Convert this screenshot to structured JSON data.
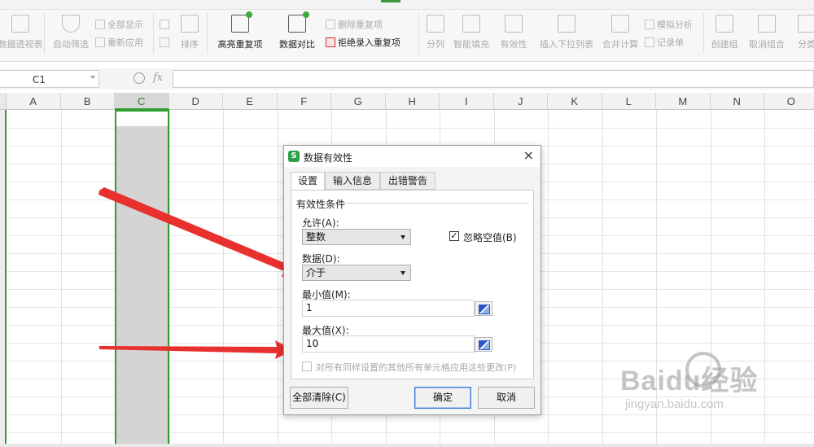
{
  "ribbon": {
    "items": [
      {
        "label": "数据透视表",
        "active": false
      },
      {
        "label": "自动筛选",
        "active": false
      },
      {
        "label": "全部显示",
        "active": false
      },
      {
        "label": "重新应用",
        "active": false
      },
      {
        "label": "排序",
        "active": false
      },
      {
        "label": "高亮重复项",
        "active": true
      },
      {
        "label": "数据对比",
        "active": true
      },
      {
        "label": "删除重复项",
        "active": false
      },
      {
        "label": "拒绝录入重复项",
        "active": true
      },
      {
        "label": "分列",
        "active": false
      },
      {
        "label": "智能填充",
        "active": false
      },
      {
        "label": "有效性",
        "active": false
      },
      {
        "label": "插入下拉列表",
        "active": false
      },
      {
        "label": "合并计算",
        "active": false
      },
      {
        "label": "模拟分析",
        "active": false
      },
      {
        "label": "记录单",
        "active": false
      },
      {
        "label": "创建组",
        "active": false
      },
      {
        "label": "取消组合",
        "active": false
      },
      {
        "label": "分类",
        "active": false
      }
    ]
  },
  "formula_bar": {
    "cell_ref": "C1",
    "fx_label": "fx",
    "content": ""
  },
  "columns": [
    "A",
    "B",
    "C",
    "D",
    "E",
    "F",
    "G",
    "H",
    "I",
    "J",
    "K",
    "L",
    "M",
    "N",
    "O"
  ],
  "selected_column": "C",
  "dialog": {
    "title": "数据有效性",
    "logo": "S",
    "close": "×",
    "tabs": [
      "设置",
      "输入信息",
      "出错警告"
    ],
    "active_tab": "设置",
    "group_title": "有效性条件",
    "allow_label": "允许(A):",
    "allow_value": "整数",
    "ignore_blank_label": "忽略空值(B)",
    "ignore_blank_checked": true,
    "data_label": "数据(D):",
    "data_value": "介于",
    "min_label": "最小值(M):",
    "min_value": "1",
    "max_label": "最大值(X):",
    "max_value": "10",
    "apply_all_label": "对所有同样设置的其他所有单元格应用这些更改(P)",
    "apply_all_checked": false,
    "clear_all_button": "全部清除(C)",
    "ok_button": "确定",
    "cancel_button": "取消"
  },
  "watermark": {
    "brand": "Baidu经验",
    "url": "jingyan.baidu.com"
  },
  "colors": {
    "selection_green": "#2e9e2e",
    "arrow_red": "#e8312f"
  }
}
